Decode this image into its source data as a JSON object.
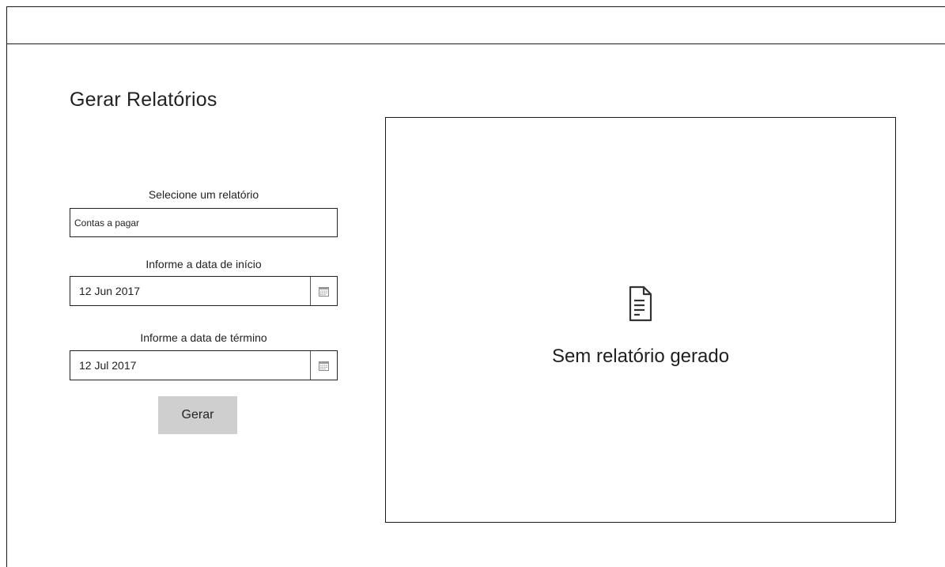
{
  "page": {
    "title": "Gerar Relatórios"
  },
  "form": {
    "report_label": "Selecione um relatório",
    "report_value": "Contas a pagar",
    "start_label": "Informe a data de início",
    "start_value": "12 Jun 2017",
    "end_label": "Informe a data de término",
    "end_value": "12 Jul 2017",
    "submit_label": "Gerar"
  },
  "report_panel": {
    "empty_message": "Sem relatório gerado",
    "empty_icon": "document-icon"
  },
  "icons": {
    "date_picker": "calendar-icon"
  },
  "colors": {
    "border": "#1a1a1a",
    "button_bg": "#cfcfcf",
    "text": "#222222"
  }
}
